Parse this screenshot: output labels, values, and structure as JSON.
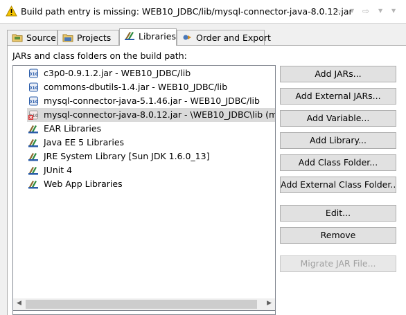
{
  "header": {
    "message": "Build path entry is missing: WEB10_JDBC/lib/mysql-connector-java-8.0.12.jar",
    "icons": [
      "warning-icon",
      "back-arrow-icon",
      "forward-arrow-icon",
      "view-menu-icon"
    ],
    "nav_glyphs": {
      "back": "⇦",
      "forward": "⇨",
      "dropdown": "▼"
    }
  },
  "tabs": [
    {
      "label": "Source",
      "icon": "source-folder-icon",
      "active": false
    },
    {
      "label": "Projects",
      "icon": "projects-icon",
      "active": false
    },
    {
      "label": "Libraries",
      "icon": "libraries-icon",
      "active": true
    },
    {
      "label": "Order and Export",
      "icon": "order-export-icon",
      "active": false
    }
  ],
  "libraries": {
    "caption": "JARs and class folders on the build path:",
    "entries": [
      {
        "label": "c3p0-0.9.1.2.jar - WEB10_JDBC/lib",
        "icon": "jar-icon",
        "selected": false
      },
      {
        "label": "commons-dbutils-1.4.jar - WEB10_JDBC/lib",
        "icon": "jar-icon",
        "selected": false
      },
      {
        "label": "mysql-connector-java-5.1.46.jar - WEB10_JDBC/lib",
        "icon": "jar-icon",
        "selected": false
      },
      {
        "label": "mysql-connector-java-8.0.12.jar - \\WEB10_JDBC\\lib (missi",
        "icon": "missing-jar-icon",
        "selected": true
      },
      {
        "label": "EAR Libraries",
        "icon": "library-icon",
        "selected": false
      },
      {
        "label": "Java EE 5 Libraries",
        "icon": "library-icon",
        "selected": false
      },
      {
        "label": "JRE System Library [Sun JDK 1.6.0_13]",
        "icon": "library-icon",
        "selected": false
      },
      {
        "label": "JUnit 4",
        "icon": "library-icon",
        "selected": false
      },
      {
        "label": "Web App Libraries",
        "icon": "library-icon",
        "selected": false
      }
    ]
  },
  "buttons": {
    "add_jars": "Add JARs...",
    "add_external_jars": "Add External JARs...",
    "add_variable": "Add Variable...",
    "add_library": "Add Library...",
    "add_class_folder": "Add Class Folder...",
    "add_external_class_folder": "Add External Class Folder...",
    "edit": "Edit...",
    "remove": "Remove",
    "migrate_jar": "Migrate JAR File..."
  },
  "colors": {
    "selection": "#dadada",
    "warning": "#f5c400",
    "jar_blue": "#2a5caa",
    "library_brown": "#8b6a2f",
    "library_green": "#2d8a3e",
    "missing_red": "#d32f2f"
  }
}
